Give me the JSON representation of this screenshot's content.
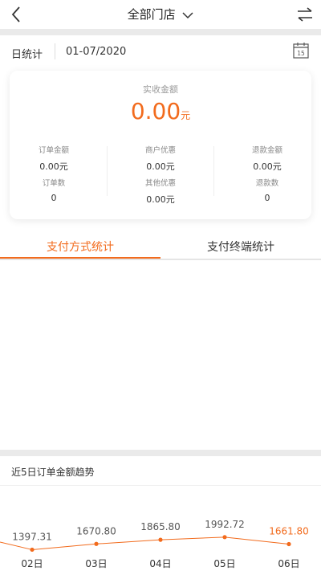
{
  "header": {
    "store_selector": "全部门店",
    "icons": {
      "back": "back-arrow-icon",
      "switch": "swap-arrows-icon",
      "dropdown": "chevron-down-icon"
    }
  },
  "stats": {
    "period_label": "日统计",
    "date": "01-07/2020",
    "calendar_icon_day": "15",
    "received_label": "实收金额",
    "received_value": "0.00",
    "received_unit": "元",
    "metrics": [
      {
        "label": "订单金额",
        "value": "0.00元"
      },
      {
        "label": "商户优惠",
        "value": "0.00元"
      },
      {
        "label": "退款金额",
        "value": "0.00元"
      },
      {
        "label": "订单数",
        "value": "0"
      },
      {
        "label": "其他优惠",
        "value": "0.00元"
      },
      {
        "label": "退款数",
        "value": "0"
      }
    ]
  },
  "tabs": [
    {
      "label": "支付方式统计",
      "active": true
    },
    {
      "label": "支付终端统计",
      "active": false
    }
  ],
  "trend": {
    "title": "近5日订单金额趋势"
  },
  "colors": {
    "accent": "#f26b1d",
    "text": "#333333",
    "muted": "#999999"
  },
  "chart_data": {
    "type": "line",
    "categories": [
      "02日",
      "03日",
      "04日",
      "05日",
      "06日"
    ],
    "values": [
      1397.31,
      1670.8,
      1865.8,
      1992.72,
      1661.8
    ],
    "value_labels": [
      "1397.31",
      "1670.80",
      "1865.80",
      "1992.72",
      "1661.80"
    ],
    "highlight_index": 4
  }
}
